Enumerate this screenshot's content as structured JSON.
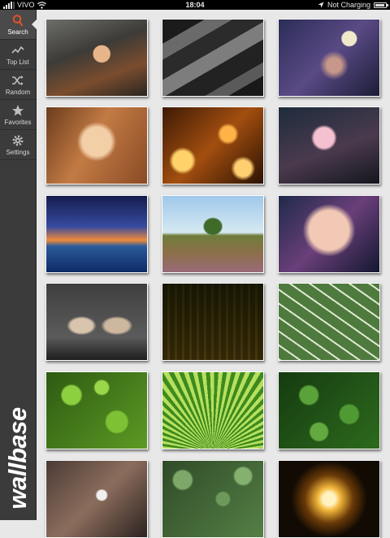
{
  "status_bar": {
    "carrier": "VIVO",
    "time": "18:04",
    "charging": "Not Charging"
  },
  "sidebar": {
    "items": [
      {
        "label": "Search",
        "icon": "search-icon"
      },
      {
        "label": "Top List",
        "icon": "trending-icon"
      },
      {
        "label": "Random",
        "icon": "shuffle-icon"
      },
      {
        "label": "Favorites",
        "icon": "star-icon"
      },
      {
        "label": "Settings",
        "icon": "gear-icon"
      }
    ],
    "brand": "wallbase"
  },
  "wallpapers": [
    "steampunk-woman",
    "gray-abstract-stripes",
    "fantasy-masked-figure",
    "blonde-woman-portrait",
    "golden-ornaments",
    "cosplay-girl-pink",
    "mountain-peak-night",
    "tree-landscape-path",
    "woman-eye-closeup",
    "two-women-posing",
    "garden-fence",
    "leaf-veins",
    "green-leaves",
    "palm-leaf",
    "variegated-leaves",
    "branch-flowers",
    "green-foliage",
    "glowing-circle"
  ],
  "colors": {
    "accent": "#e0532a",
    "sidebar": "#3b3b3b",
    "background": "#e8e8e8"
  }
}
